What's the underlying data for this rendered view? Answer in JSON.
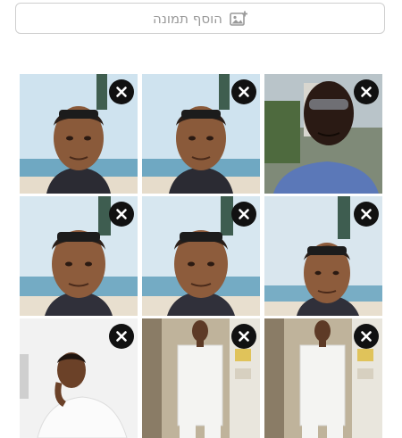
{
  "uploader": {
    "add_photo_label": "הוסף תמונה",
    "add_photo_icon": "add-photo-icon",
    "remove_icon": "close-icon"
  },
  "photos": [
    {
      "scene": "beach-selfie"
    },
    {
      "scene": "beach-selfie"
    },
    {
      "scene": "dark-selfie"
    },
    {
      "scene": "beach-selfie-2"
    },
    {
      "scene": "beach-selfie-2"
    },
    {
      "scene": "beach-selfie-3"
    },
    {
      "scene": "white-shirt-pose"
    },
    {
      "scene": "white-suit-standing"
    },
    {
      "scene": "white-suit-standing"
    }
  ],
  "colors": {
    "button_border": "#cfcfcf",
    "button_text": "#9a9a9a",
    "remove_bg": "#111111",
    "remove_x": "#ffffff"
  }
}
